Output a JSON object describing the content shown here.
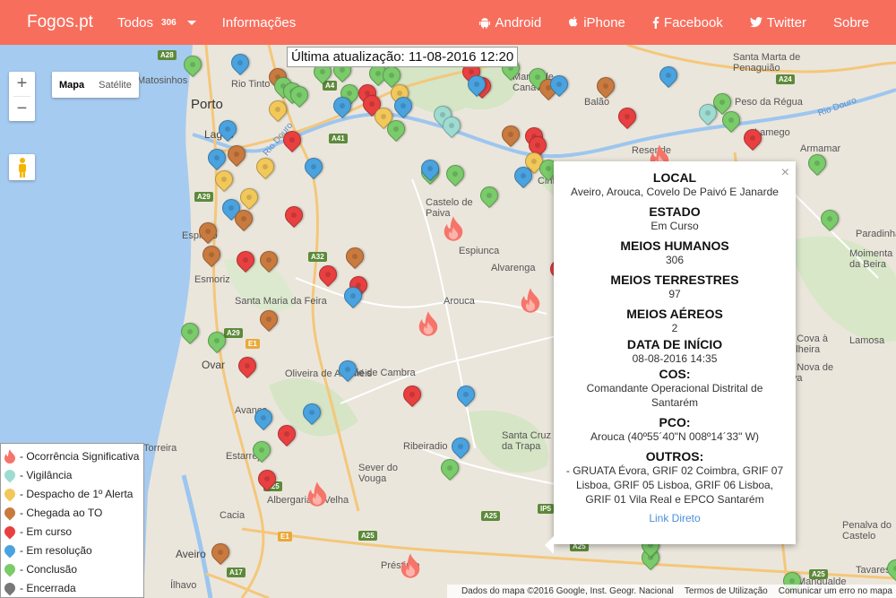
{
  "nav": {
    "brand": "Fogos.pt",
    "todos_label": "Todos",
    "todos_count": "306",
    "info_label": "Informações",
    "android_label": "Android",
    "iphone_label": "iPhone",
    "facebook_label": "Facebook",
    "twitter_label": "Twitter",
    "sobre_label": "Sobre"
  },
  "map": {
    "last_update": "Última atualização: 11-08-2016 12:20",
    "zoom_in": "+",
    "zoom_out": "−",
    "map_type_map": "Mapa",
    "map_type_satellite": "Satélite",
    "places": {
      "porto": "Porto",
      "matosinhos": "Matosinhos",
      "rio_tinto": "Rio Tinto",
      "lagos": "Lagos",
      "espinho": "Espinho",
      "esmoriz": "Esmoriz",
      "santa_maria_da_feira": "Santa Maria da Feira",
      "ovar": "Ovar",
      "oliveira": "Oliveira de Azeméis",
      "vale_de_cambra": "Vale de Cambra",
      "arouca": "Arouca",
      "alvarenga": "Alvarenga",
      "espiunca": "Espiunca",
      "castelo_de_paiva": "Castelo de Paiva",
      "cinfaes": "Cinfães",
      "balao": "Balão",
      "marco_canaveses": "Marco de Canaveses",
      "peso_da_regua": "Peso da Régua",
      "santa_marta": "Santa Marta de Penaguião",
      "lamego": "Lamego",
      "armamar": "Armamar",
      "resende": "Resende",
      "torreira": "Torreira",
      "estarreja": "Estarreja",
      "albergaria": "Albergaria-a-Velha",
      "cacia": "Cacia",
      "aveiro": "Aveiro",
      "ilhavo": "Ílhavo",
      "prestimo": "Préstimo",
      "ribeiradio": "Ribeiradio",
      "sever_do_vouga": "Sever do Vouga",
      "santa_cruz": "Santa Cruz da Trapa",
      "paradinha": "Paradinha",
      "moimenta": "Moimenta da Beira",
      "lamosa": "Lamosa",
      "penalva": "Penalva do Castelo",
      "mangualde": "Mangualde",
      "tavares": "Tavares",
      "vila_cova": "Vila Cova à Coelheira",
      "vila_nova_paiva": "Vila Nova de Paiva",
      "avanca": "Avanca"
    },
    "rivers": {
      "douro1": "Rio Douro",
      "douro2": "Rio Douro"
    },
    "roads": [
      "A28",
      "A4",
      "A41",
      "A29",
      "A32",
      "A29",
      "E1",
      "A24",
      "A25",
      "A25",
      "A17",
      "A25",
      "E1",
      "IP5",
      "A25",
      "A25"
    ]
  },
  "info": {
    "local_label": "LOCAL",
    "local_value": "Aveiro, Arouca, Covelo De Paivó E Janarde",
    "estado_label": "ESTADO",
    "estado_value": "Em Curso",
    "humanos_label": "MEIOS HUMANOS",
    "humanos_value": "306",
    "terrestres_label": "MEIOS TERRESTRES",
    "terrestres_value": "97",
    "aereos_label": "MEIOS AÉREOS",
    "aereos_value": "2",
    "data_label": "DATA DE INÍCIO",
    "data_value": "08-08-2016 14:35",
    "cos_label": "COS:",
    "cos_value": "Comandante Operacional Distrital de Santarém",
    "pco_label": "PCO:",
    "pco_value": "Arouca (40º55´40\"N 008º14´33\" W)",
    "outros_label": "OUTROS:",
    "outros_value": "- GRUATA Évora, GRIF 02 Coimbra, GRIF 07 Lisboa, GRIF 05 Lisboa, GRIF 06 Lisboa, GRIF 01 Vila Real e EPCO Santarém",
    "link_label": "Link Direto",
    "close_label": "×"
  },
  "legend": {
    "items": [
      {
        "label": "- Ocorrência Significativa",
        "color": "#f6756a",
        "icon": "flame-icon"
      },
      {
        "label": "- Vigilância",
        "color": "#9edbd1",
        "icon": "marker-icon"
      },
      {
        "label": "- Despacho de 1º Alerta",
        "color": "#f2c85b",
        "icon": "marker-icon"
      },
      {
        "label": "- Chegada ao TO",
        "color": "#c97a3f",
        "icon": "marker-icon"
      },
      {
        "label": "- Em curso",
        "color": "#e84040",
        "icon": "marker-icon"
      },
      {
        "label": "- Em resolução",
        "color": "#4aa3df",
        "icon": "marker-icon"
      },
      {
        "label": "- Conclusão",
        "color": "#7acb6a",
        "icon": "marker-icon"
      },
      {
        "label": "- Encerrada",
        "color": "#777777",
        "icon": "marker-icon"
      }
    ]
  },
  "attribution": {
    "data": "Dados do mapa ©2016 Google, Inst. Geogr. Nacional",
    "terms": "Termos de Utilização",
    "report": "Comunicar um erro no mapa"
  },
  "colors": {
    "nav": "#f76e5d",
    "sea": "#a6cbf0",
    "land": "#ebe6dc",
    "em_curso": "#e84040",
    "em_resolucao": "#4aa3df",
    "conclusao": "#7acb6a",
    "chegada": "#c97a3f",
    "despacho": "#f2c85b",
    "vigilancia": "#9edbd1",
    "significativa": "#f6756a"
  }
}
